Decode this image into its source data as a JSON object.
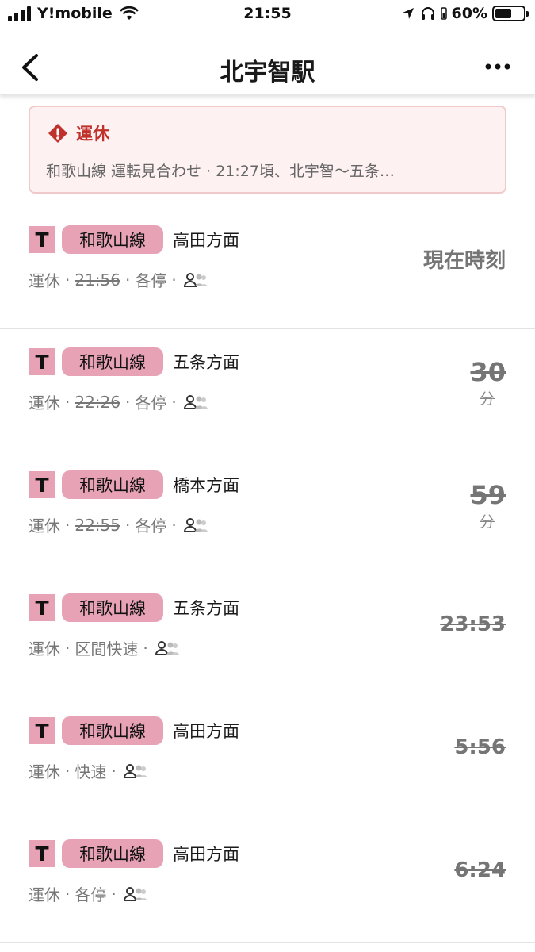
{
  "status_bar": {
    "carrier": "Y!mobile",
    "time": "21:55",
    "battery_percent": "60%",
    "battery_level": 0.6
  },
  "nav": {
    "title": "北宇智駅"
  },
  "alert": {
    "title": "運休",
    "text": "和歌山線 運転見合わせ · 21:27頃、北宇智〜五条…"
  },
  "colors": {
    "line_badge": "#e8a2b5",
    "alert_red": "#c0312b",
    "alert_bg": "#fdf1f1"
  },
  "departures": [
    {
      "badge": "T",
      "line": "和歌山線",
      "direction": "高田方面",
      "status": "運休",
      "time": "21:56",
      "type": "各停",
      "right": "現在時刻"
    },
    {
      "badge": "T",
      "line": "和歌山線",
      "direction": "五条方面",
      "status": "運休",
      "time": "22:26",
      "type": "各停",
      "right_num": "30",
      "right_unit": "分"
    },
    {
      "badge": "T",
      "line": "和歌山線",
      "direction": "橋本方面",
      "status": "運休",
      "time": "22:55",
      "type": "各停",
      "right_num": "59",
      "right_unit": "分"
    },
    {
      "badge": "T",
      "line": "和歌山線",
      "direction": "五条方面",
      "status": "運休",
      "type": "区間快速",
      "right": "23:53"
    },
    {
      "badge": "T",
      "line": "和歌山線",
      "direction": "高田方面",
      "status": "運休",
      "type": "快速",
      "right": "5:56"
    },
    {
      "badge": "T",
      "line": "和歌山線",
      "direction": "高田方面",
      "status": "運休",
      "type": "各停",
      "right": "6:24"
    }
  ]
}
